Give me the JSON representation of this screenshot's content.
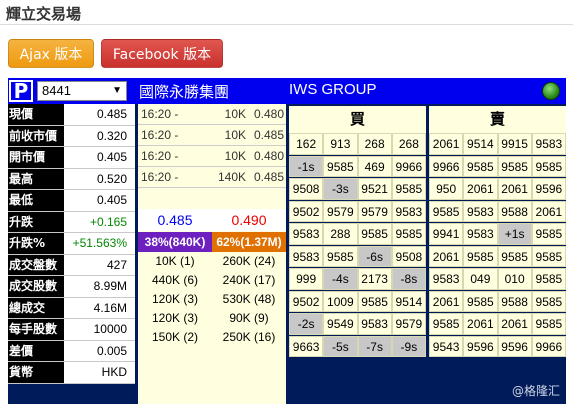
{
  "page": {
    "title": "輝立交易場"
  },
  "buttons": {
    "ajax": "Ajax 版本",
    "facebook": "Facebook 版本"
  },
  "topbar": {
    "logo": "P",
    "stock_code": "8441",
    "caret": "▼",
    "name_zh": "國際永勝集團",
    "name_en": "IWS GROUP",
    "status_color": "#2c8c1a"
  },
  "quote": [
    {
      "label": "現價",
      "value": "0.485",
      "tone": ""
    },
    {
      "label": "前收市價",
      "value": "0.320",
      "tone": ""
    },
    {
      "label": "開市價",
      "value": "0.405",
      "tone": ""
    },
    {
      "label": "最高",
      "value": "0.520",
      "tone": ""
    },
    {
      "label": "最低",
      "value": "0.405",
      "tone": ""
    },
    {
      "label": "升跌",
      "value": "+0.165",
      "tone": "green"
    },
    {
      "label": "升跌%",
      "value": "+51.563%",
      "tone": "green"
    },
    {
      "label": "成交盤數",
      "value": "427",
      "tone": ""
    },
    {
      "label": "成交股數",
      "value": "8.99M",
      "tone": ""
    },
    {
      "label": "總成交",
      "value": "4.16M",
      "tone": ""
    },
    {
      "label": "每手股數",
      "value": "10000",
      "tone": ""
    },
    {
      "label": "差價",
      "value": "0.005",
      "tone": ""
    },
    {
      "label": "貨幣",
      "value": "HKD",
      "tone": ""
    }
  ],
  "trades": [
    {
      "time": "16:20 -",
      "vol": "10K",
      "price": "0.480"
    },
    {
      "time": "16:20 -",
      "vol": "10K",
      "price": "0.485"
    },
    {
      "time": "16:20 -",
      "vol": "10K",
      "price": "0.480"
    },
    {
      "time": "16:20 -",
      "vol": "140K",
      "price": "0.485"
    }
  ],
  "bid_price": "0.485",
  "ask_price": "0.490",
  "ratio": {
    "buy": "38%(840K)",
    "sell": "62%(1.37M)"
  },
  "queue_levels": [
    {
      "buy": "10K (1)",
      "sell": "260K (24)"
    },
    {
      "buy": "440K (6)",
      "sell": "240K (17)"
    },
    {
      "buy": "120K (3)",
      "sell": "530K (48)"
    },
    {
      "buy": "120K (3)",
      "sell": "90K (9)"
    },
    {
      "buy": "150K (2)",
      "sell": "250K (16)"
    }
  ],
  "queue_headers": {
    "buy": "買",
    "sell": "賣"
  },
  "queue_grid": [
    [
      [
        "162",
        ""
      ],
      [
        "913",
        ""
      ],
      [
        "268",
        ""
      ],
      [
        "268",
        ""
      ],
      [
        "2061",
        ""
      ],
      [
        "9514",
        ""
      ],
      [
        "9915",
        ""
      ],
      [
        "9583",
        ""
      ]
    ],
    [
      [
        "-1s",
        "gray"
      ],
      [
        "9585",
        ""
      ],
      [
        "469",
        ""
      ],
      [
        "9966",
        ""
      ],
      [
        "9966",
        ""
      ],
      [
        "9585",
        ""
      ],
      [
        "9585",
        ""
      ],
      [
        "9585",
        ""
      ]
    ],
    [
      [
        "9508",
        ""
      ],
      [
        "-3s",
        "gray"
      ],
      [
        "9521",
        ""
      ],
      [
        "9585",
        ""
      ],
      [
        "950",
        ""
      ],
      [
        "2061",
        ""
      ],
      [
        "2061",
        ""
      ],
      [
        "9596",
        ""
      ]
    ],
    [
      [
        "9502",
        ""
      ],
      [
        "9579",
        ""
      ],
      [
        "9579",
        ""
      ],
      [
        "9583",
        ""
      ],
      [
        "9585",
        ""
      ],
      [
        "9583",
        ""
      ],
      [
        "9588",
        ""
      ],
      [
        "2061",
        ""
      ]
    ],
    [
      [
        "9583",
        ""
      ],
      [
        "288",
        ""
      ],
      [
        "9585",
        ""
      ],
      [
        "9585",
        ""
      ],
      [
        "9941",
        ""
      ],
      [
        "9583",
        ""
      ],
      [
        "+1s",
        "gray"
      ],
      [
        "9585",
        ""
      ]
    ],
    [
      [
        "9583",
        ""
      ],
      [
        "9585",
        ""
      ],
      [
        "-6s",
        "gray"
      ],
      [
        "9508",
        ""
      ],
      [
        "2061",
        ""
      ],
      [
        "9585",
        ""
      ],
      [
        "9585",
        ""
      ],
      [
        "9585",
        ""
      ]
    ],
    [
      [
        "999",
        ""
      ],
      [
        "-4s",
        "gray"
      ],
      [
        "2173",
        ""
      ],
      [
        "-8s",
        "gray"
      ],
      [
        "9583",
        ""
      ],
      [
        "049",
        ""
      ],
      [
        "010",
        ""
      ],
      [
        "9585",
        ""
      ]
    ],
    [
      [
        "9502",
        ""
      ],
      [
        "1009",
        ""
      ],
      [
        "9585",
        ""
      ],
      [
        "9514",
        ""
      ],
      [
        "2061",
        ""
      ],
      [
        "9585",
        ""
      ],
      [
        "9588",
        ""
      ],
      [
        "9585",
        ""
      ]
    ],
    [
      [
        "-2s",
        "gray"
      ],
      [
        "9549",
        ""
      ],
      [
        "9583",
        ""
      ],
      [
        "9579",
        ""
      ],
      [
        "9585",
        ""
      ],
      [
        "2061",
        ""
      ],
      [
        "2061",
        ""
      ],
      [
        "9585",
        ""
      ]
    ],
    [
      [
        "9663",
        ""
      ],
      [
        "-5s",
        "gray"
      ],
      [
        "-7s",
        "gray"
      ],
      [
        "-9s",
        "gray"
      ],
      [
        "9543",
        ""
      ],
      [
        "9596",
        ""
      ],
      [
        "9596",
        ""
      ],
      [
        "9966",
        ""
      ]
    ]
  ],
  "dash": "–",
  "watermark": "@格隆汇"
}
